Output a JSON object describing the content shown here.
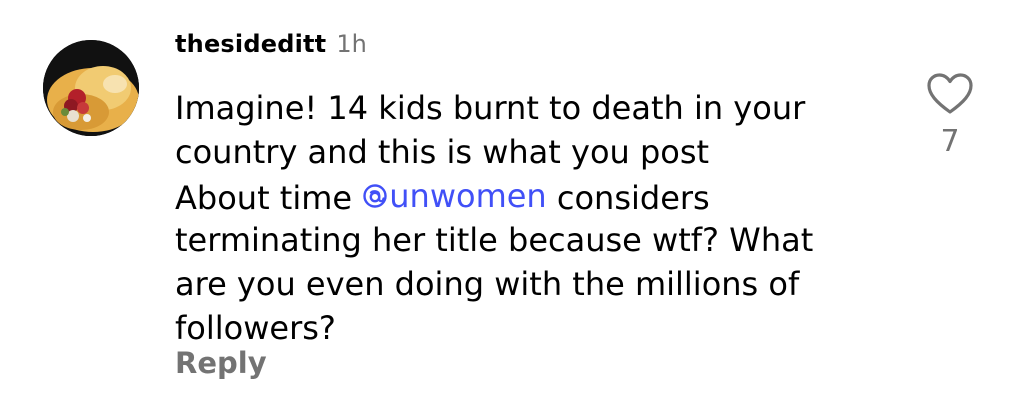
{
  "comment": {
    "username": "thesideditt",
    "timestamp": "1h",
    "lines": [
      "Imagine! 14 kids burnt to death in your",
      "country and this is what you post",
      "About time",
      "considers",
      "terminating her title because wtf? What",
      "are you even doing with the millions of",
      "followers?"
    ],
    "mention": "unwomen",
    "reply_label": "Reply",
    "like_count": "7"
  },
  "icons": {
    "like": "heart-outline-icon",
    "mention": "threads-at-icon"
  },
  "colors": {
    "mention": "#4150f7",
    "secondary_text": "#737373",
    "primary_text": "#000000"
  }
}
